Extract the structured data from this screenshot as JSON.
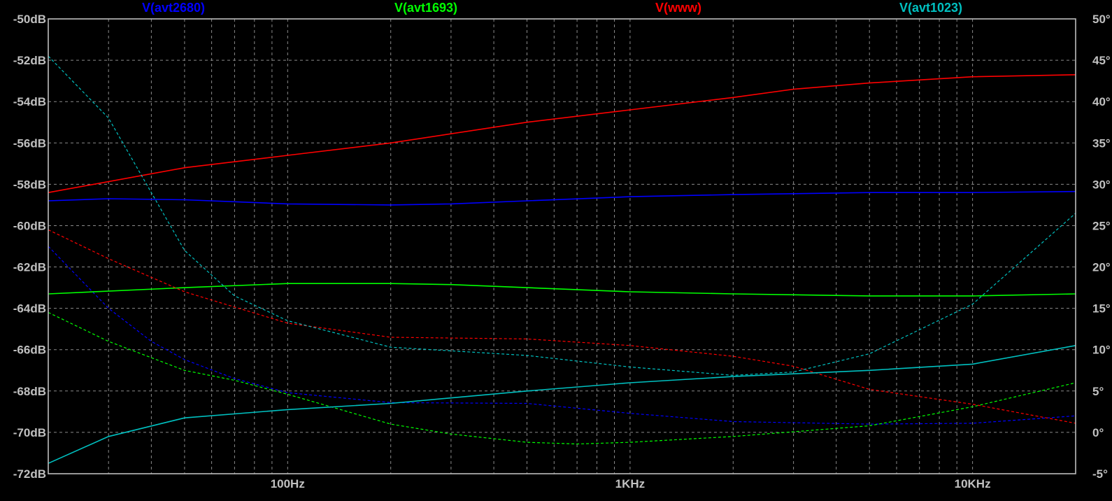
{
  "chart_data": {
    "type": "line",
    "title": "",
    "xlabel": "",
    "ylabel_left": "",
    "ylabel_right": "",
    "x_scale": "log",
    "xlim": [
      20,
      20000
    ],
    "ylim_left": [
      -72,
      -50
    ],
    "ylim_right": [
      -5,
      50
    ],
    "grid": true,
    "legend_position": "top",
    "x_ticks": [
      {
        "value": 100,
        "label": "100Hz"
      },
      {
        "value": 1000,
        "label": "1KHz"
      },
      {
        "value": 10000,
        "label": "10KHz"
      }
    ],
    "y_left_ticks": [
      {
        "value": -50,
        "label": "-50dB"
      },
      {
        "value": -52,
        "label": "-52dB"
      },
      {
        "value": -54,
        "label": "-54dB"
      },
      {
        "value": -56,
        "label": "-56dB"
      },
      {
        "value": -58,
        "label": "-58dB"
      },
      {
        "value": -60,
        "label": "-60dB"
      },
      {
        "value": -62,
        "label": "-62dB"
      },
      {
        "value": -64,
        "label": "-64dB"
      },
      {
        "value": -66,
        "label": "-66dB"
      },
      {
        "value": -68,
        "label": "-68dB"
      },
      {
        "value": -70,
        "label": "-70dB"
      },
      {
        "value": -72,
        "label": "-72dB"
      }
    ],
    "y_right_ticks": [
      {
        "value": 50,
        "label": "50°"
      },
      {
        "value": 45,
        "label": "45°"
      },
      {
        "value": 40,
        "label": "40°"
      },
      {
        "value": 35,
        "label": "35°"
      },
      {
        "value": 30,
        "label": "30°"
      },
      {
        "value": 25,
        "label": "25°"
      },
      {
        "value": 20,
        "label": "20°"
      },
      {
        "value": 15,
        "label": "15°"
      },
      {
        "value": 10,
        "label": "10°"
      },
      {
        "value": 5,
        "label": "5°"
      },
      {
        "value": 0,
        "label": "0°"
      },
      {
        "value": -5,
        "label": "-5°"
      }
    ],
    "series": [
      {
        "name": "V(avt2680)",
        "color": "#0000ff",
        "magnitude_db": [
          [
            20,
            -58.8
          ],
          [
            30,
            -58.7
          ],
          [
            50,
            -58.75
          ],
          [
            100,
            -58.95
          ],
          [
            200,
            -59.0
          ],
          [
            300,
            -58.95
          ],
          [
            500,
            -58.8
          ],
          [
            1000,
            -58.6
          ],
          [
            2000,
            -58.5
          ],
          [
            5000,
            -58.4
          ],
          [
            10000,
            -58.4
          ],
          [
            20000,
            -58.35
          ]
        ],
        "phase_deg": [
          [
            20,
            22.5
          ],
          [
            30,
            15
          ],
          [
            40,
            11
          ],
          [
            50,
            8.8
          ],
          [
            70,
            6.5
          ],
          [
            100,
            4.8
          ],
          [
            200,
            3.6
          ],
          [
            500,
            3.5
          ],
          [
            1000,
            2.3
          ],
          [
            2000,
            1.3
          ],
          [
            5000,
            1.0
          ],
          [
            10000,
            1.1
          ],
          [
            20000,
            2.0
          ]
        ]
      },
      {
        "name": "V(avt1693)",
        "color": "#00ff00",
        "magnitude_db": [
          [
            20,
            -63.3
          ],
          [
            50,
            -63.0
          ],
          [
            100,
            -62.8
          ],
          [
            200,
            -62.8
          ],
          [
            300,
            -62.85
          ],
          [
            500,
            -63.0
          ],
          [
            1000,
            -63.2
          ],
          [
            2000,
            -63.3
          ],
          [
            5000,
            -63.4
          ],
          [
            10000,
            -63.4
          ],
          [
            20000,
            -63.3
          ]
        ],
        "phase_deg": [
          [
            20,
            14.5
          ],
          [
            30,
            11
          ],
          [
            50,
            7.5
          ],
          [
            70,
            6.3
          ],
          [
            100,
            4.6
          ],
          [
            200,
            1.0
          ],
          [
            300,
            -0.2
          ],
          [
            500,
            -1.2
          ],
          [
            700,
            -1.4
          ],
          [
            1000,
            -1.2
          ],
          [
            2000,
            -0.5
          ],
          [
            5000,
            0.8
          ],
          [
            10000,
            3.1
          ],
          [
            20000,
            6.0
          ]
        ]
      },
      {
        "name": "V(www)",
        "color": "#ff0000",
        "magnitude_db": [
          [
            20,
            -58.4
          ],
          [
            50,
            -57.2
          ],
          [
            100,
            -56.6
          ],
          [
            200,
            -56.0
          ],
          [
            500,
            -55.0
          ],
          [
            1000,
            -54.4
          ],
          [
            2000,
            -53.8
          ],
          [
            3000,
            -53.4
          ],
          [
            5000,
            -53.1
          ],
          [
            10000,
            -52.8
          ],
          [
            20000,
            -52.7
          ]
        ],
        "phase_deg": [
          [
            20,
            24.5
          ],
          [
            30,
            21
          ],
          [
            50,
            17
          ],
          [
            100,
            13.2
          ],
          [
            200,
            11.5
          ],
          [
            500,
            11.3
          ],
          [
            1000,
            10.5
          ],
          [
            2000,
            9.2
          ],
          [
            3000,
            8.0
          ],
          [
            5000,
            5.2
          ],
          [
            10000,
            3.4
          ],
          [
            20000,
            1.1
          ]
        ]
      },
      {
        "name": "V(avt1023)",
        "color": "#00c0c0",
        "magnitude_db": [
          [
            20,
            -71.5
          ],
          [
            30,
            -70.2
          ],
          [
            50,
            -69.3
          ],
          [
            100,
            -68.9
          ],
          [
            200,
            -68.6
          ],
          [
            500,
            -68.0
          ],
          [
            1000,
            -67.6
          ],
          [
            2000,
            -67.3
          ],
          [
            5000,
            -67.0
          ],
          [
            10000,
            -66.7
          ],
          [
            20000,
            -65.8
          ]
        ],
        "phase_deg": [
          [
            20,
            45.5
          ],
          [
            30,
            38
          ],
          [
            50,
            22
          ],
          [
            70,
            16.5
          ],
          [
            100,
            13.5
          ],
          [
            200,
            10.3
          ],
          [
            500,
            9.3
          ],
          [
            1000,
            7.9
          ],
          [
            2000,
            6.9
          ],
          [
            3000,
            7.3
          ],
          [
            5000,
            9.5
          ],
          [
            10000,
            15.5
          ],
          [
            20000,
            26.5
          ]
        ]
      }
    ]
  }
}
